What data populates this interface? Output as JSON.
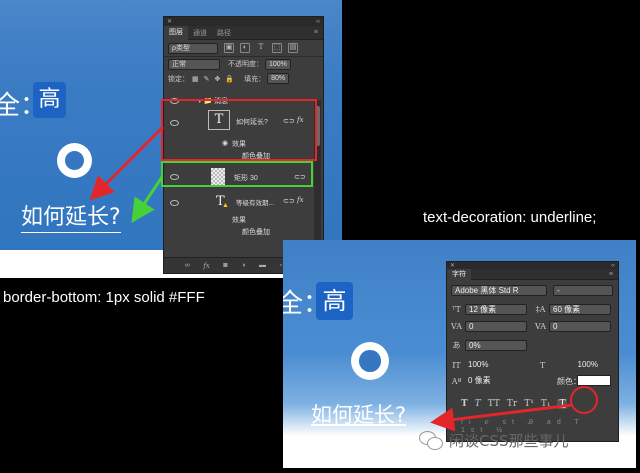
{
  "top_screenshot": {
    "label_fragment": "全：",
    "label_value": "高",
    "link_text": "如何延长?",
    "layers_panel": {
      "tabs": [
        "图层",
        "通道",
        "路径"
      ],
      "filter_kind": "ρ类型",
      "blend_mode": "正常",
      "opacity_label": "不透明度：",
      "opacity_value": "100%",
      "lock_label": "锁定：",
      "fill_label": "填充：",
      "fill_value": "80%",
      "group_name": "▾ 📁 消息",
      "layers": [
        {
          "name": "如何延长?",
          "fx": "fx",
          "effects_label": "效果",
          "effect_item": "颜色叠加"
        },
        {
          "name": "矩形 30"
        },
        {
          "name": "等级有效期...",
          "fx": "fx",
          "effects_label": "效果",
          "effect_item": "颜色叠加"
        }
      ],
      "footer_icons": [
        "link-icon",
        "fx-icon",
        "mask-icon",
        "adjustment-icon",
        "folder-icon",
        "new-layer-icon",
        "trash-icon"
      ]
    }
  },
  "captions": {
    "top": "border-bottom: 1px solid #FFF",
    "bottom": "text-decoration: underline;"
  },
  "bottom_screenshot": {
    "label_fragment": "全：",
    "label_value": "高",
    "link_text": "如何延长?",
    "watermark": "闲谈CSS那些事儿",
    "character_panel": {
      "tab": "字符",
      "font_family": "Adobe 黑体 Std R",
      "font_style": "-",
      "font_size": "12 像素",
      "leading": "60 像素",
      "kerning": "0",
      "tracking": "0",
      "tsume": "0%",
      "vertical_scale": "100%",
      "horizontal_scale": "100%",
      "baseline_shift": "0 像素",
      "color_label": "颜色：",
      "type_buttons": [
        "T",
        "T",
        "TT",
        "Tr",
        "T¹",
        "T₁",
        "T"
      ]
    }
  },
  "colors": {
    "highlight_red": "#e3262a",
    "highlight_green": "#47d139",
    "page_bg": "#000000"
  }
}
